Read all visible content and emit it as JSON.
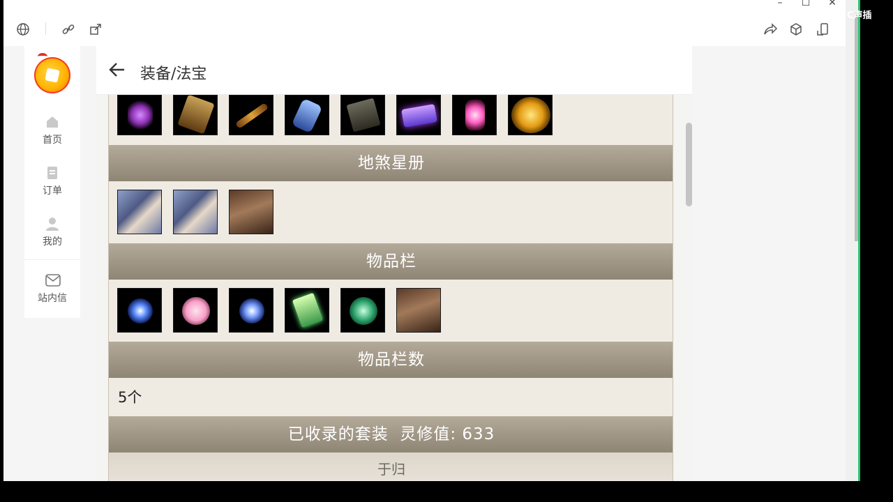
{
  "window": {
    "toolbar_left_icons": [
      "globe-icon",
      "link-icon",
      "external-link-icon"
    ],
    "toolbar_right_icons": [
      "share-icon",
      "cube-icon",
      "phone-icon"
    ],
    "controls": [
      "minimize",
      "maximize",
      "close"
    ],
    "overlay_text": "C声插"
  },
  "sidebar": {
    "items": [
      {
        "label": "首页",
        "icon": "home-icon"
      },
      {
        "label": "订单",
        "icon": "order-icon"
      },
      {
        "label": "我的",
        "icon": "user-icon"
      },
      {
        "label": "站内信",
        "icon": "mail-icon"
      }
    ]
  },
  "header": {
    "title": "装备/法宝"
  },
  "sections": {
    "top_items": [
      "lantern-artifact",
      "tablet-artifact",
      "flute-artifact",
      "gauntlet-artifact",
      "book-artifact",
      "scroll-artifact",
      "lamp-artifact",
      "gold-artifact"
    ],
    "disha": {
      "title": "地煞星册",
      "items": [
        "card-warrior-woman",
        "card-warrior-woman-2",
        "card-warrior-man"
      ]
    },
    "inventory": {
      "title": "物品栏",
      "items": [
        "blue-gem",
        "pink-heart",
        "blue-crystal",
        "green-card",
        "green-orb",
        "card-warrior-man"
      ]
    },
    "inventory_count": {
      "title": "物品栏数",
      "value": "5个"
    },
    "sets": {
      "title": "已收录的套装  灵修值: 633",
      "first_set": "于归"
    }
  },
  "colors": {
    "section_header": "#9d9382",
    "content_bg": "#efebe3",
    "accent_logo": "#ffb300"
  }
}
